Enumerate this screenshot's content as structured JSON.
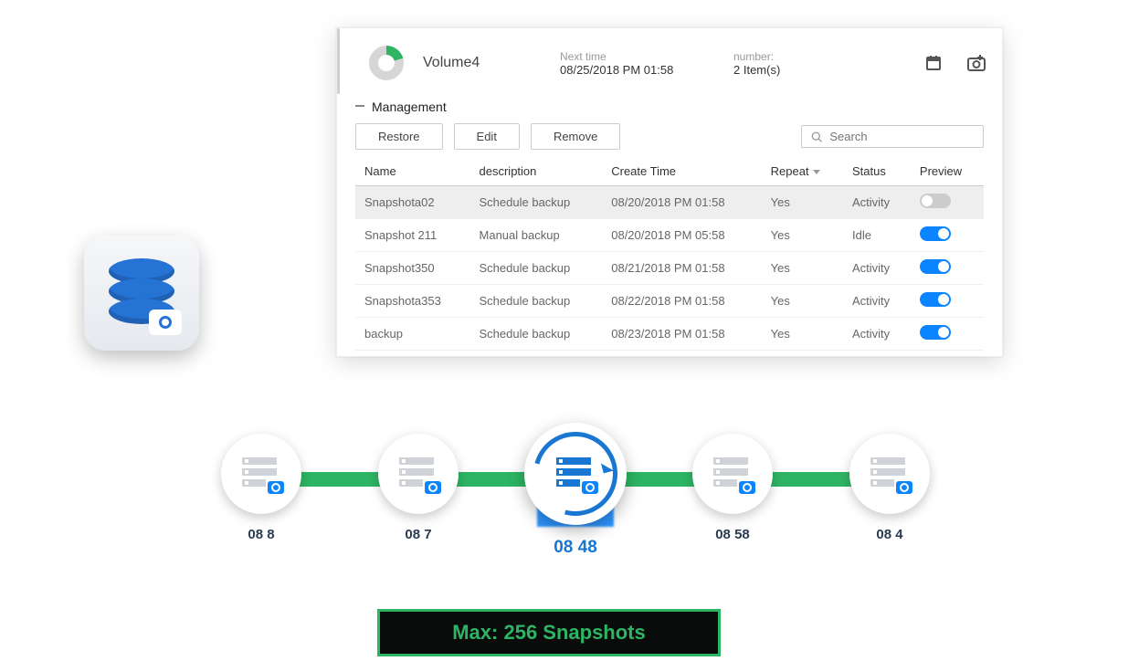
{
  "header": {
    "volume_name": "Volume4",
    "next_time_label": "Next time",
    "next_time_value": "08/25/2018 PM 01:58",
    "number_label": "number:",
    "number_value": "2 Item(s)"
  },
  "section": {
    "title": "Management"
  },
  "toolbar": {
    "restore_label": "Restore",
    "edit_label": "Edit",
    "remove_label": "Remove",
    "search_placeholder": "Search"
  },
  "columns": {
    "name": "Name",
    "description": "description",
    "create_time": "Create Time",
    "repeat": "Repeat",
    "status": "Status",
    "preview": "Preview"
  },
  "rows": [
    {
      "name": "Snapshota02",
      "description": "Schedule backup",
      "create_time": "08/20/2018 PM 01:58",
      "repeat": "Yes",
      "status": "Activity",
      "status_kind": "activity",
      "preview_on": false,
      "selected": true
    },
    {
      "name": "Snapshot 211",
      "description": "Manual backup",
      "create_time": "08/20/2018 PM 05:58",
      "repeat": "Yes",
      "status": "Idle",
      "status_kind": "idle",
      "preview_on": true,
      "selected": false
    },
    {
      "name": "Snapshot350",
      "description": "Schedule backup",
      "create_time": "08/21/2018 PM 01:58",
      "repeat": "Yes",
      "status": "Activity",
      "status_kind": "activity",
      "preview_on": true,
      "selected": false
    },
    {
      "name": "Snapshota353",
      "description": "Schedule backup",
      "create_time": "08/22/2018 PM 01:58",
      "repeat": "Yes",
      "status": "Activity",
      "status_kind": "activity",
      "preview_on": true,
      "selected": false
    },
    {
      "name": "backup",
      "description": "Schedule backup",
      "create_time": "08/23/2018 PM 01:58",
      "repeat": "Yes",
      "status": "Activity",
      "status_kind": "activity",
      "preview_on": true,
      "selected": false
    }
  ],
  "timeline": {
    "items": [
      {
        "label": "08           8",
        "active": false
      },
      {
        "label": "08           7",
        "active": false
      },
      {
        "label": "08             48",
        "active": true
      },
      {
        "label": "08          58",
        "active": false
      },
      {
        "label": "08           4",
        "active": false
      }
    ]
  },
  "max_badge": {
    "text": "Max: 256 Snapshots"
  }
}
